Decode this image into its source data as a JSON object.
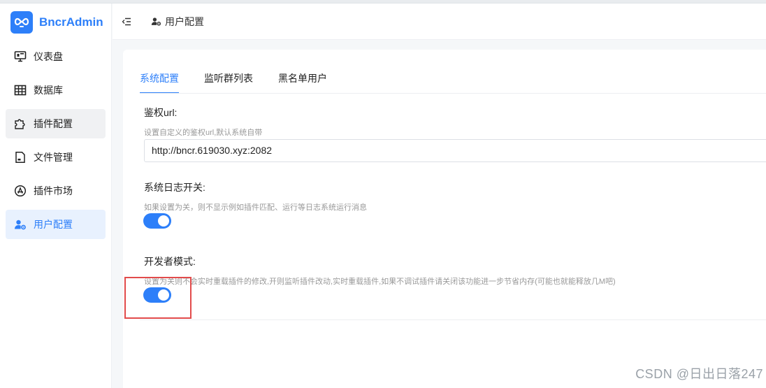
{
  "app": {
    "name": "BncrAdmin",
    "accent": "#2d7ff9"
  },
  "sidebar": {
    "items": [
      {
        "label": "仪表盘",
        "icon": "dashboard-icon"
      },
      {
        "label": "数据库",
        "icon": "table-icon"
      },
      {
        "label": "插件配置",
        "icon": "puzzle-icon"
      },
      {
        "label": "文件管理",
        "icon": "file-icon"
      },
      {
        "label": "插件市场",
        "icon": "app-store-icon"
      },
      {
        "label": "用户配置",
        "icon": "user-settings-icon"
      }
    ],
    "active_index": 5,
    "hover_index": 2
  },
  "header": {
    "breadcrumb": "用户配置"
  },
  "tabs": [
    {
      "label": "系统配置",
      "active": true
    },
    {
      "label": "监听群列表",
      "active": false
    },
    {
      "label": "黑名单用户",
      "active": false
    }
  ],
  "settings": {
    "auth_url": {
      "label": "鉴权url:",
      "description": "设置自定义的鉴权url,默认系统自带",
      "value": "http://bncr.619030.xyz:2082"
    },
    "system_log": {
      "label": "系统日志开关:",
      "description": "如果设置为关，则不显示例如插件匹配、运行等日志系统运行消息",
      "enabled": true
    },
    "dev_mode": {
      "label": "开发者模式:",
      "description": "设置为关则不会实时重载插件的修改,开则监听插件改动,实时重载插件,如果不调试插件请关闭该功能进一步节省内存(可能也就能释放几M吧)",
      "enabled": true
    }
  },
  "watermark": "CSDN @日出日落247"
}
